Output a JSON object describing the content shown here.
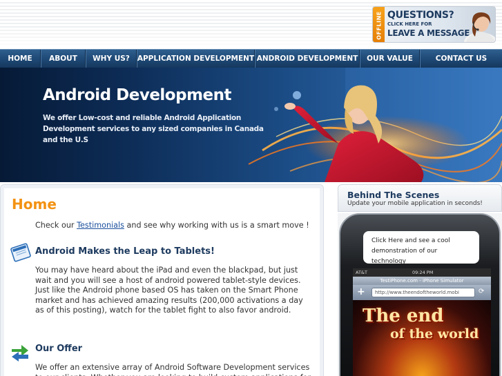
{
  "chat": {
    "offline": "OFFLINE",
    "questions": "QUESTIONS?",
    "click_here": "CLICK HERE FOR",
    "leave_message": "LEAVE A MESSAGE"
  },
  "nav": {
    "items": [
      {
        "label": "HOME"
      },
      {
        "label": "ABOUT"
      },
      {
        "label": "WHY US?"
      },
      {
        "label": "APPLICATION DEVELOPMENT"
      },
      {
        "label": "ANDROID DEVELOPMENT"
      },
      {
        "label": "OUR VALUE"
      },
      {
        "label": "CONTACT US"
      }
    ]
  },
  "hero": {
    "title": "Android Development",
    "subtitle": "We offer Low-cost and reliable Android Application Development services to any sized companies in Canada and the U.S"
  },
  "main": {
    "title": "Home",
    "intro_prefix": "Check our ",
    "intro_link": "Testimonials",
    "intro_suffix": " and see why working with us is a smart move !",
    "sections": [
      {
        "heading": "Android Makes the Leap to Tablets!",
        "body": "You may have heard about the iPad and even the blackpad, but just wait and you will see a host of android powered tablet-style devices.  Just like the Android phone based OS has taken on the Smart Phone market and has achieved amazing results (200,000 activations a day as of this posting), watch for the tablet fight to also favor android."
      },
      {
        "heading": "Our Offer",
        "body": "We offer an extensive array of Android Software Development services to our clients. Whether you are looking to build custom applications for smartphones and"
      }
    ]
  },
  "sidebar": {
    "title": "Behind The Scenes",
    "subtitle": "Update your mobile application in seconds!",
    "bubble": "Click Here and see a cool demonstration of our technology",
    "status_carrier": "AT&T",
    "status_time": "09:24 PM",
    "address_title": "TestiPhone.com - iPhone Simulator",
    "address_url": "http://www.theendoftheworld.mobi",
    "movie_line1": "The end",
    "movie_line2": "of the world"
  },
  "colors": {
    "nav": "#1e4874",
    "accent_orange": "#f39214",
    "heading_blue": "#1d3a5f",
    "link_blue": "#1a4f9c"
  }
}
